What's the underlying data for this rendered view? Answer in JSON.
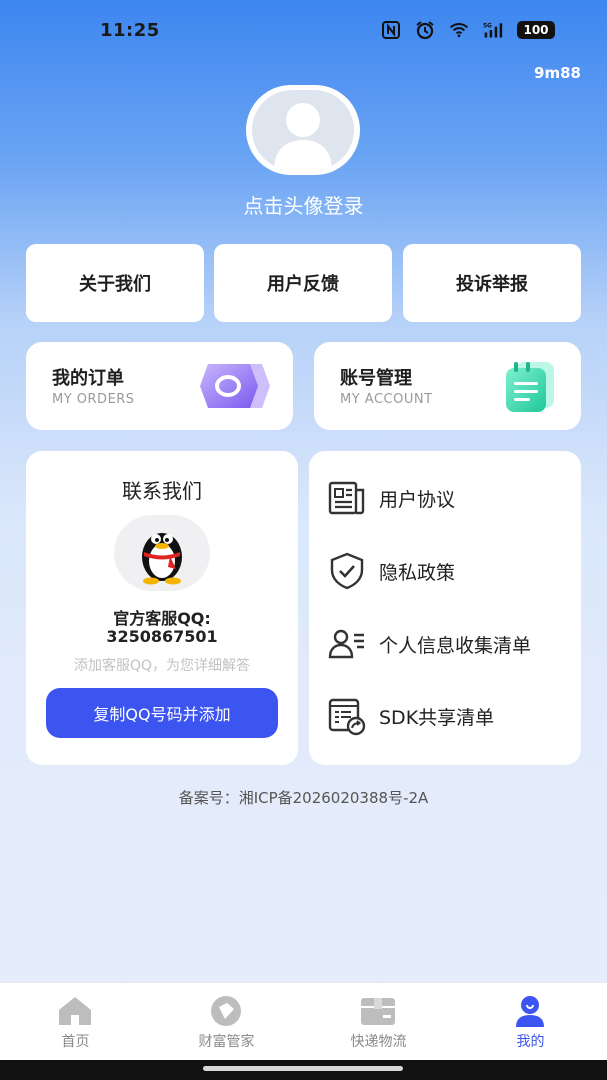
{
  "status_bar": {
    "time": "11:25",
    "battery": "100",
    "icons": [
      "nfc-icon",
      "alarm-icon",
      "wifi-icon",
      "5g-signal-icon",
      "battery-icon"
    ]
  },
  "profile": {
    "user_code": "9m88",
    "avatar_icon": "default-avatar-icon",
    "login_prompt": "点击头像登录"
  },
  "quick_actions": [
    {
      "label": "关于我们"
    },
    {
      "label": "用户反馈"
    },
    {
      "label": "投诉举报"
    }
  ],
  "feature_cards": [
    {
      "title": "我的订单",
      "subtitle": "MY ORDERS",
      "icon": "orders-icon"
    },
    {
      "title": "账号管理",
      "subtitle": "MY ACCOUNT",
      "icon": "account-notepad-icon"
    }
  ],
  "contact": {
    "title": "联系我们",
    "icon": "qq-penguin-icon",
    "qq_label": "官方客服QQ:",
    "qq_number": "3250867501",
    "hint": "添加客服QQ，为您详细解答",
    "copy_button": "复制QQ号码并添加"
  },
  "policy_links": [
    {
      "label": "用户协议",
      "icon": "document-icon"
    },
    {
      "label": "隐私政策",
      "icon": "shield-check-icon"
    },
    {
      "label": "个人信息收集清单",
      "icon": "user-list-icon"
    },
    {
      "label": "SDK共享清单",
      "icon": "sdk-share-icon"
    }
  ],
  "icp": "备案号：湘ICP备2026020388号-2A",
  "tabbar": [
    {
      "label": "首页",
      "icon": "home-icon",
      "active": false
    },
    {
      "label": "财富管家",
      "icon": "wealth-icon",
      "active": false
    },
    {
      "label": "快递物流",
      "icon": "package-icon",
      "active": false
    },
    {
      "label": "我的",
      "icon": "profile-icon",
      "active": true
    }
  ],
  "colors": {
    "accent": "#3d55f0",
    "header_blue": "#3d86f0",
    "order_icon": "#8b6cf5",
    "account_icon": "#2fd3a8"
  }
}
